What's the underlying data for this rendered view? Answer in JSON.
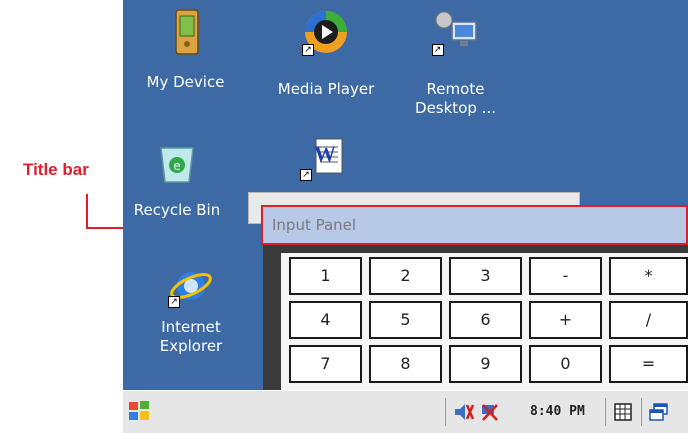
{
  "annotation": {
    "title_bar_label": "Title bar",
    "color": "#e11d2a"
  },
  "desktop": {
    "background": "#3d6aa5",
    "icons": [
      {
        "name": "my-device",
        "label1": "My Device",
        "label2": "",
        "icon": "pda-icon"
      },
      {
        "name": "media-player",
        "label1": "Media Player",
        "label2": "",
        "icon": "media-player-icon"
      },
      {
        "name": "remote-desktop",
        "label1": "Remote",
        "label2": "Desktop ...",
        "icon": "remote-desktop-icon"
      },
      {
        "name": "recycle-bin",
        "label1": "Recycle Bin",
        "label2": "",
        "icon": "recycle-bin-icon"
      },
      {
        "name": "word",
        "label1": "",
        "label2": "",
        "icon": "word-document-icon"
      },
      {
        "name": "internet-explorer",
        "label1": "Internet",
        "label2": "Explorer",
        "icon": "internet-explorer-icon"
      }
    ]
  },
  "input_panel": {
    "title": "Input Panel",
    "keys": [
      [
        "1",
        "2",
        "3",
        "-",
        "*"
      ],
      [
        "4",
        "5",
        "6",
        "+",
        "/"
      ],
      [
        "7",
        "8",
        "9",
        "0",
        "="
      ]
    ]
  },
  "taskbar": {
    "time": "8:40 PM",
    "start_icon": "windows-flag-icon",
    "tray_icons": [
      "volume-icon",
      "network-icon",
      "keyboard-icon",
      "window-switch-icon"
    ]
  }
}
